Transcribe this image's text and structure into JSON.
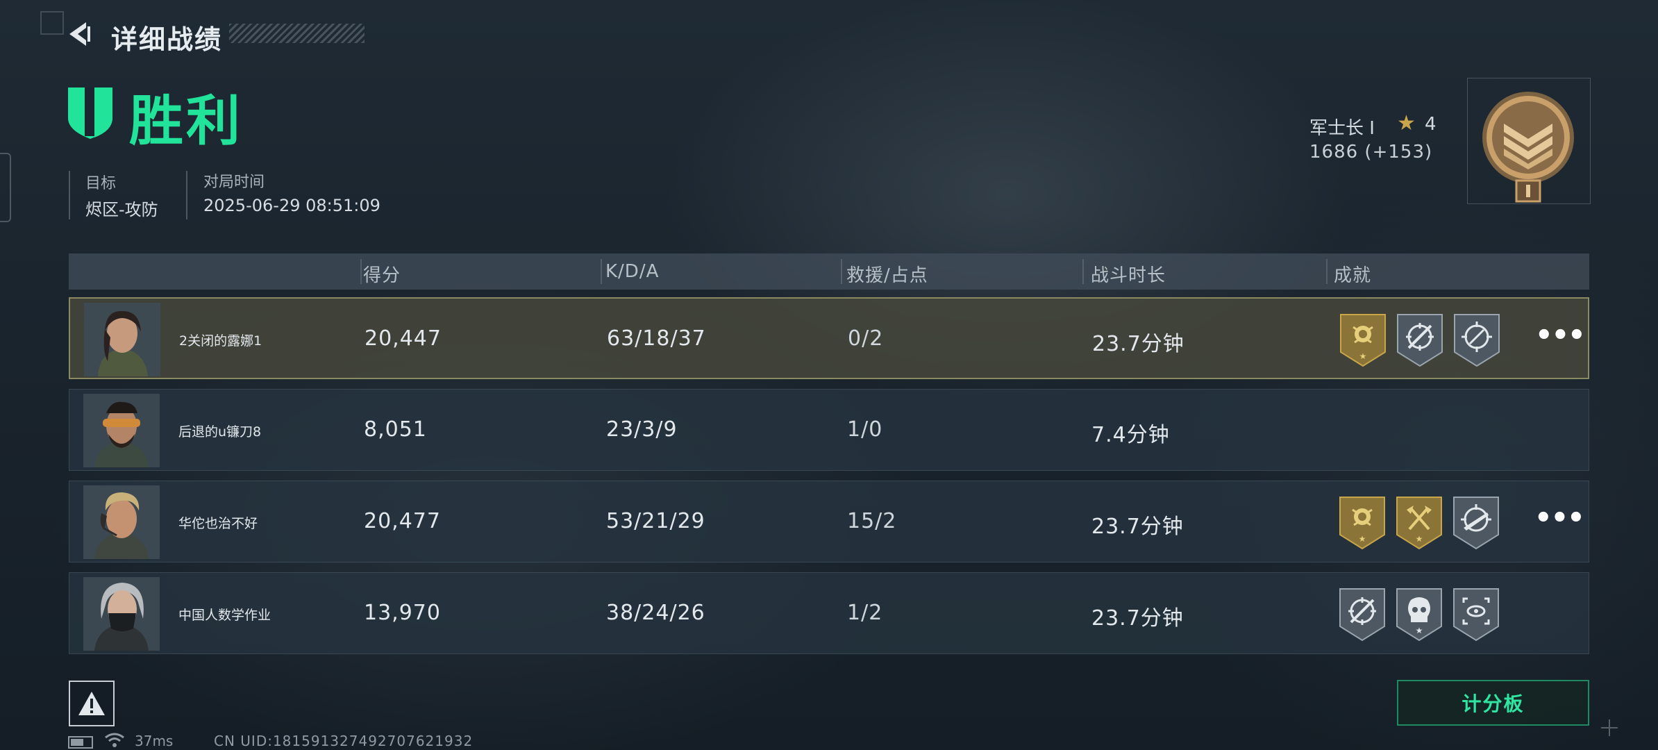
{
  "header": {
    "title": "详细战绩",
    "result": "胜利"
  },
  "match_info": {
    "target_label": "目标",
    "target_value": "烬区-攻防",
    "time_label": "对局时间",
    "time_value": "2025-06-29 08:51:09"
  },
  "rank": {
    "name": "军士长 I",
    "stars": "4",
    "points": "1686 (+153)"
  },
  "table": {
    "columns": [
      "得分",
      "K/D/A",
      "救援/占点",
      "战斗时长",
      "成就"
    ],
    "rows": [
      {
        "name": "2关闭的露娜1",
        "score": "20,447",
        "kda": "63/18/37",
        "rescue": "0/2",
        "duration": "23.7分钟",
        "achievements": [
          "gold-rose-badge-icon",
          "silver-sniper-badge-icon",
          "silver-crosshair-badge-icon"
        ],
        "has_more": true,
        "avatar": "avatar-female-soldier"
      },
      {
        "name": "后退的u镰刀8",
        "score": "8,051",
        "kda": "23/3/9",
        "rescue": "1/0",
        "duration": "7.4分钟",
        "achievements": [],
        "has_more": false,
        "avatar": "avatar-bearded-goggles"
      },
      {
        "name": "华佗也治不好",
        "score": "20,477",
        "kda": "53/21/29",
        "rescue": "15/2",
        "duration": "23.7分钟",
        "achievements": [
          "gold-rose-badge-icon",
          "gold-axes-badge-icon",
          "silver-rifle-badge-icon"
        ],
        "has_more": true,
        "avatar": "avatar-blond-headset"
      },
      {
        "name": "中国人数学作业",
        "score": "13,970",
        "kda": "38/24/26",
        "rescue": "1/2",
        "duration": "23.7分钟",
        "achievements": [
          "silver-sniper-badge-icon",
          "silver-skull-badge-icon",
          "silver-eye-badge-icon"
        ],
        "has_more": false,
        "avatar": "avatar-masked-silver-hair"
      }
    ]
  },
  "footer": {
    "scoreboard_label": "计分板",
    "ping": "37ms",
    "uid": "CN UID:181591327492707621932"
  },
  "colors": {
    "accent_green": "#21e39a",
    "gold": "#c9a64a",
    "active_row_border": "#8b8960"
  }
}
